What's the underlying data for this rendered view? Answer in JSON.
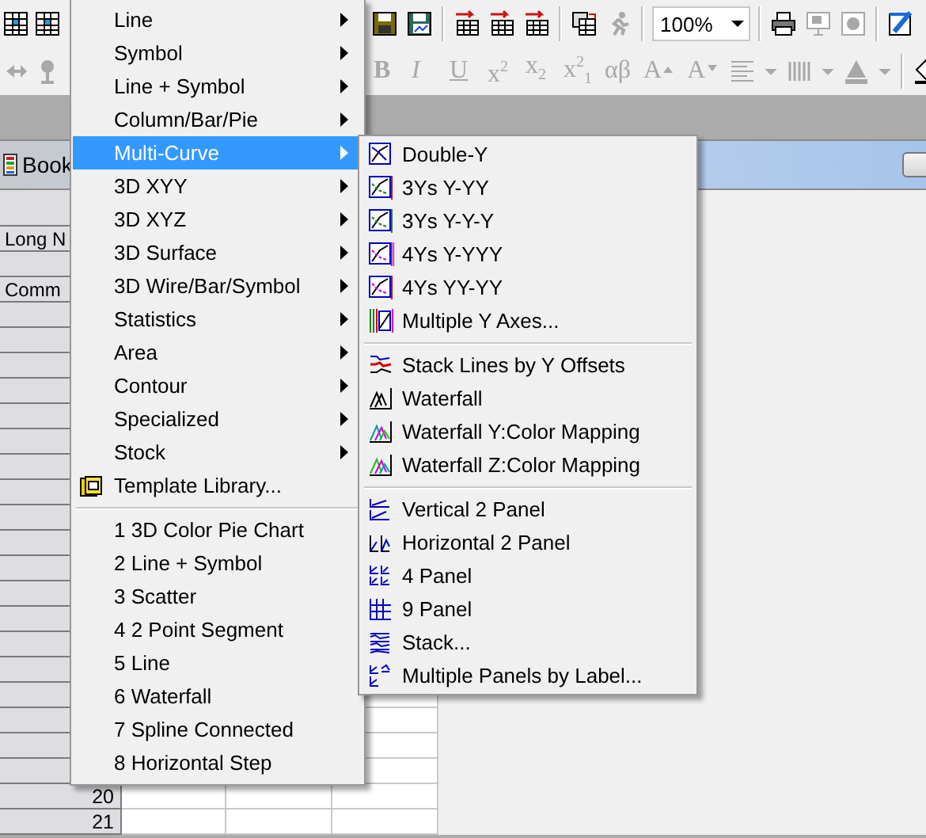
{
  "toolbar": {
    "rows": [
      {
        "left": [
          {
            "kind": "spreadsheet",
            "disabled": false
          },
          {
            "kind": "spreadsheet",
            "disabled": false
          }
        ],
        "right": [
          {
            "kind": "save",
            "disabled": false
          },
          {
            "kind": "save-graph",
            "disabled": false
          },
          {
            "kind": "separator"
          },
          {
            "kind": "import",
            "disabled": false
          },
          {
            "kind": "import",
            "disabled": false
          },
          {
            "kind": "import",
            "disabled": false
          },
          {
            "kind": "separator"
          },
          {
            "kind": "duplicate",
            "disabled": false
          },
          {
            "kind": "runner",
            "disabled": true
          },
          {
            "kind": "separator"
          },
          {
            "kind": "combo",
            "value": "100%"
          },
          {
            "kind": "separator"
          },
          {
            "kind": "printer",
            "disabled": false
          },
          {
            "kind": "easel",
            "disabled": true
          },
          {
            "kind": "frame",
            "disabled": true
          },
          {
            "kind": "separator"
          },
          {
            "kind": "pen",
            "disabled": false
          }
        ]
      },
      {
        "left": [
          {
            "kind": "pointer",
            "disabled": true
          },
          {
            "kind": "pin",
            "disabled": true
          }
        ],
        "right": [
          {
            "kind": "bold",
            "label": "B",
            "disabled": true
          },
          {
            "kind": "italic",
            "label": "I",
            "disabled": true
          },
          {
            "kind": "underline",
            "label": "U",
            "disabled": true
          },
          {
            "kind": "text",
            "label": "x$^{2}$",
            "disabled": true
          },
          {
            "kind": "text",
            "label": "x$_{2}$",
            "disabled": true
          },
          {
            "kind": "text",
            "label": "x$^{2}$$_{1}$",
            "disabled": true
          },
          {
            "kind": "text",
            "label": "αβ",
            "disabled": true
          },
          {
            "kind": "grow",
            "label": "A",
            "disabled": true
          },
          {
            "kind": "shrink",
            "label": "A",
            "disabled": true
          },
          {
            "kind": "align",
            "disabled": true
          },
          {
            "kind": "caret",
            "disabled": true
          },
          {
            "kind": "bars",
            "disabled": true
          },
          {
            "kind": "caret",
            "disabled": true
          },
          {
            "kind": "fill",
            "disabled": true
          },
          {
            "kind": "caret",
            "disabled": true
          },
          {
            "kind": "separator"
          },
          {
            "kind": "bucket",
            "disabled": false
          }
        ]
      }
    ]
  },
  "book": {
    "title": "Book",
    "header_labels": [
      "Long N",
      "Comm"
    ],
    "rows": [
      {
        "number": "20"
      },
      {
        "number": "21"
      }
    ]
  },
  "menu": {
    "items": [
      {
        "kind": "item",
        "label": "Line",
        "submenu": true,
        "selected": false
      },
      {
        "kind": "item",
        "label": "Symbol",
        "submenu": true,
        "selected": false
      },
      {
        "kind": "item",
        "label": "Line + Symbol",
        "submenu": true,
        "selected": false
      },
      {
        "kind": "item",
        "label": "Column/Bar/Pie",
        "submenu": true,
        "selected": false
      },
      {
        "kind": "item",
        "label": "Multi-Curve",
        "submenu": true,
        "selected": true
      },
      {
        "kind": "item",
        "label": "3D XYY",
        "submenu": true,
        "selected": false
      },
      {
        "kind": "item",
        "label": "3D XYZ",
        "submenu": true,
        "selected": false
      },
      {
        "kind": "item",
        "label": "3D Surface",
        "submenu": true,
        "selected": false
      },
      {
        "kind": "item",
        "label": "3D Wire/Bar/Symbol",
        "submenu": true,
        "selected": false
      },
      {
        "kind": "item",
        "label": "Statistics",
        "submenu": true,
        "selected": false
      },
      {
        "kind": "item",
        "label": "Area",
        "submenu": true,
        "selected": false
      },
      {
        "kind": "item",
        "label": "Contour",
        "submenu": true,
        "selected": false
      },
      {
        "kind": "item",
        "label": "Specialized",
        "submenu": true,
        "selected": false
      },
      {
        "kind": "item",
        "label": "Stock",
        "submenu": true,
        "selected": false
      },
      {
        "kind": "icon-item",
        "label": "Template Library...",
        "submenu": false,
        "selected": false
      },
      {
        "kind": "separator"
      },
      {
        "kind": "item",
        "label": "1 3D Color Pie Chart",
        "submenu": false,
        "selected": false
      },
      {
        "kind": "item",
        "label": "2 Line + Symbol",
        "submenu": false,
        "selected": false
      },
      {
        "kind": "item",
        "label": "3 Scatter",
        "submenu": false,
        "selected": false
      },
      {
        "kind": "item",
        "label": "4 2 Point Segment",
        "submenu": false,
        "selected": false
      },
      {
        "kind": "item",
        "label": "5 Line",
        "submenu": false,
        "selected": false
      },
      {
        "kind": "item",
        "label": "6 Waterfall",
        "submenu": false,
        "selected": false
      },
      {
        "kind": "item",
        "label": "7 Spline Connected",
        "submenu": false,
        "selected": false
      },
      {
        "kind": "item",
        "label": "8 Horizontal Step",
        "submenu": false,
        "selected": false
      }
    ]
  },
  "submenu": {
    "items": [
      {
        "kind": "item",
        "label": "Double-Y",
        "selected": false
      },
      {
        "kind": "item",
        "label": "3Ys Y-YY",
        "selected": false
      },
      {
        "kind": "item",
        "label": "3Ys Y-Y-Y",
        "selected": false
      },
      {
        "kind": "item",
        "label": "4Ys Y-YYY",
        "selected": false
      },
      {
        "kind": "item",
        "label": "4Ys YY-YY",
        "selected": false
      },
      {
        "kind": "item",
        "label": "Multiple Y Axes...",
        "selected": false
      },
      {
        "kind": "separator"
      },
      {
        "kind": "item",
        "label": "Stack Lines by Y Offsets",
        "selected": false
      },
      {
        "kind": "item",
        "label": "Waterfall",
        "selected": false
      },
      {
        "kind": "item",
        "label": "Waterfall Y:Color Mapping",
        "selected": false
      },
      {
        "kind": "item",
        "label": "Waterfall Z:Color Mapping",
        "selected": false
      },
      {
        "kind": "separator"
      },
      {
        "kind": "item",
        "label": "Vertical 2 Panel",
        "selected": false
      },
      {
        "kind": "item",
        "label": "Horizontal 2 Panel",
        "selected": false
      },
      {
        "kind": "item",
        "label": "4 Panel",
        "selected": false
      },
      {
        "kind": "item",
        "label": "9 Panel",
        "selected": false
      },
      {
        "kind": "item",
        "label": "Stack...",
        "selected": false
      },
      {
        "kind": "item",
        "label": "Multiple Panels by Label...",
        "selected": false
      }
    ]
  }
}
